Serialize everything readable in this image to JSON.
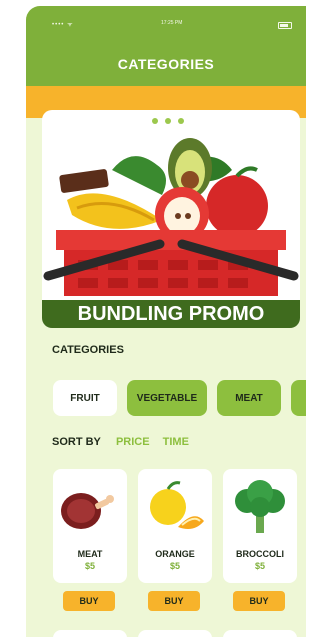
{
  "status": {
    "left": "•••• ᯤ",
    "time": "17:25 PM"
  },
  "header": {
    "title": "CATEGORIES"
  },
  "banner": {
    "label": "BUNDLING PROMO"
  },
  "categories": {
    "title": "CATEGORIES",
    "items": [
      {
        "label": "FRUIT",
        "selected": false
      },
      {
        "label": "VEGETABLE",
        "selected": true
      },
      {
        "label": "MEAT",
        "selected": true
      }
    ]
  },
  "sort": {
    "label": "SORT BY",
    "options": [
      "PRICE",
      "TIME"
    ]
  },
  "products": [
    {
      "name": "MEAT",
      "price": "$5",
      "buy": "BUY"
    },
    {
      "name": "ORANGE",
      "price": "$5",
      "buy": "BUY"
    },
    {
      "name": "BROCCOLI",
      "price": "$5",
      "buy": "BUY"
    }
  ],
  "colors": {
    "header": "#7fb03a",
    "accent_orange": "#f7b32b",
    "chip_green": "#8dbf3e",
    "page_bg": "#eef7d6"
  }
}
